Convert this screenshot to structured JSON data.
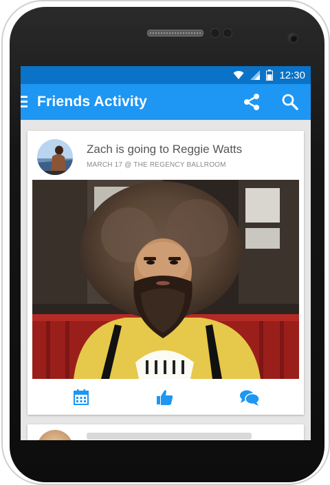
{
  "status_bar": {
    "time": "12:30",
    "icons": [
      "wifi-icon",
      "signal-icon",
      "battery-icon"
    ]
  },
  "app_bar": {
    "title": "Friends Activity",
    "menu_icon": "hamburger-menu-icon",
    "actions": [
      "share-icon",
      "search-icon"
    ]
  },
  "feed": {
    "items": [
      {
        "headline": "Zach is going to Reggie Watts",
        "subline": "MARCH 17 @ THE REGENCY BALLROOM",
        "avatar": "avatar",
        "actions": [
          "calendar-icon",
          "thumbs-up-icon",
          "comments-icon"
        ]
      }
    ]
  },
  "colors": {
    "status_bar": "#0a73c7",
    "app_bar": "#1e96f3",
    "accent": "#1e96f3",
    "background": "#e6e6e6"
  }
}
